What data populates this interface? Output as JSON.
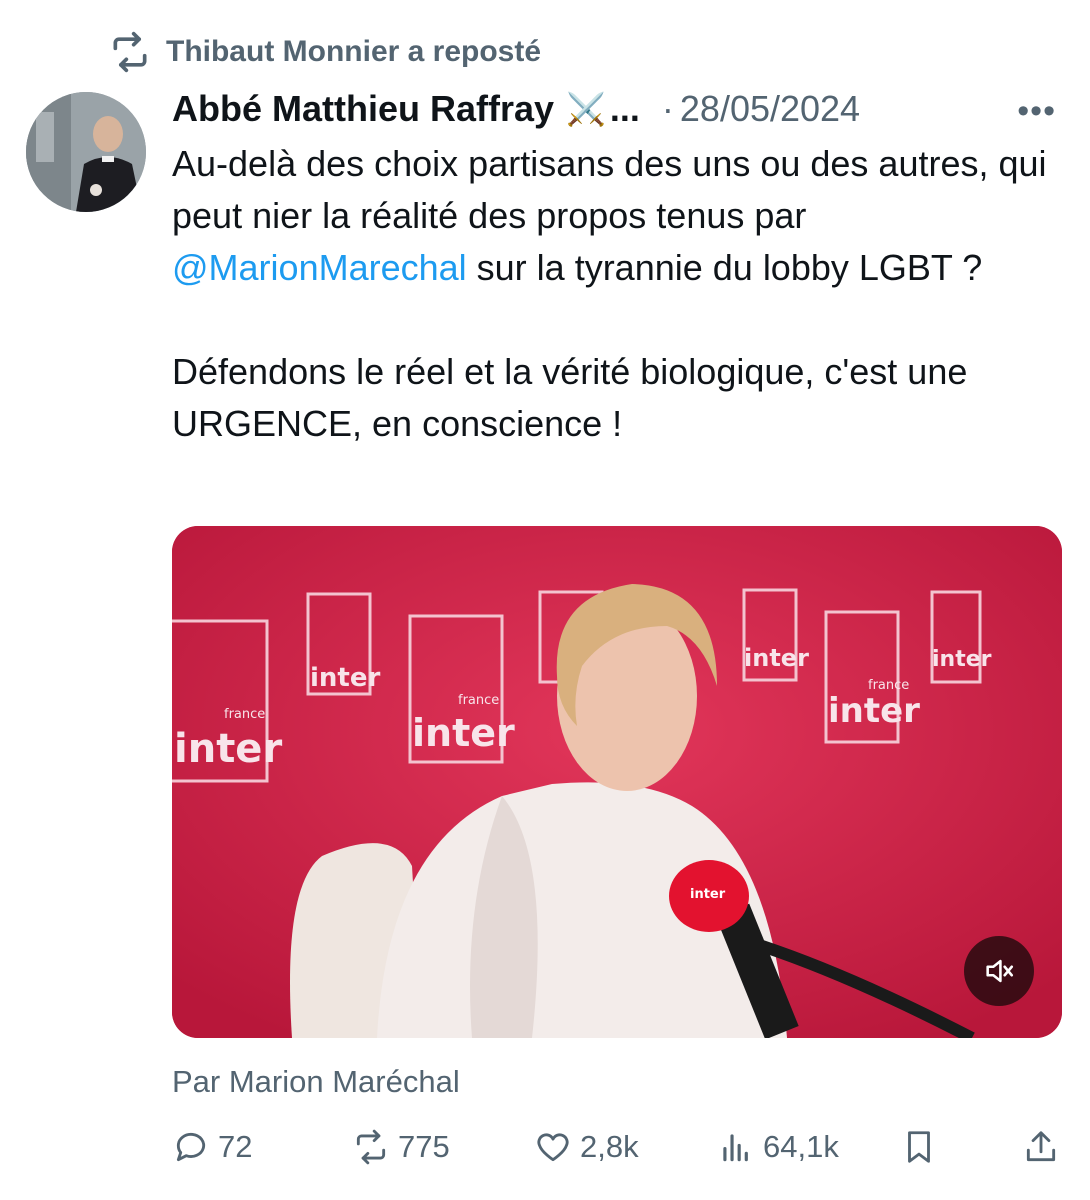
{
  "repost": {
    "icon": "repost-icon",
    "text": "Thibaut Monnier a reposté"
  },
  "tweet": {
    "author": "Abbé Matthieu Raffray",
    "author_emoji": "⚔️",
    "truncation": "...",
    "separator": "·",
    "date": "28/05/2024",
    "more_label": "•••",
    "text_line1": "Au-delà des choix partisans des uns ou des autres, qui peut nier la réalité des propos tenus par ",
    "mention": "@MarionMarechal",
    "text_line1_end": " sur la tyrannie du lobby LGBT ?",
    "text_para2": "Défendons le réel et la vérité biologique, c'est une URGENCE, en conscience !",
    "media_branding": [
      "france",
      "inter"
    ],
    "attribution": "Par Marion Maréchal"
  },
  "actions": {
    "replies": "72",
    "reposts": "775",
    "likes": "2,8k",
    "views": "64,1k"
  },
  "colors": {
    "text": "#0f1419",
    "secondary": "#536471",
    "link": "#1d9bf0",
    "media_background": "#cf2447"
  }
}
